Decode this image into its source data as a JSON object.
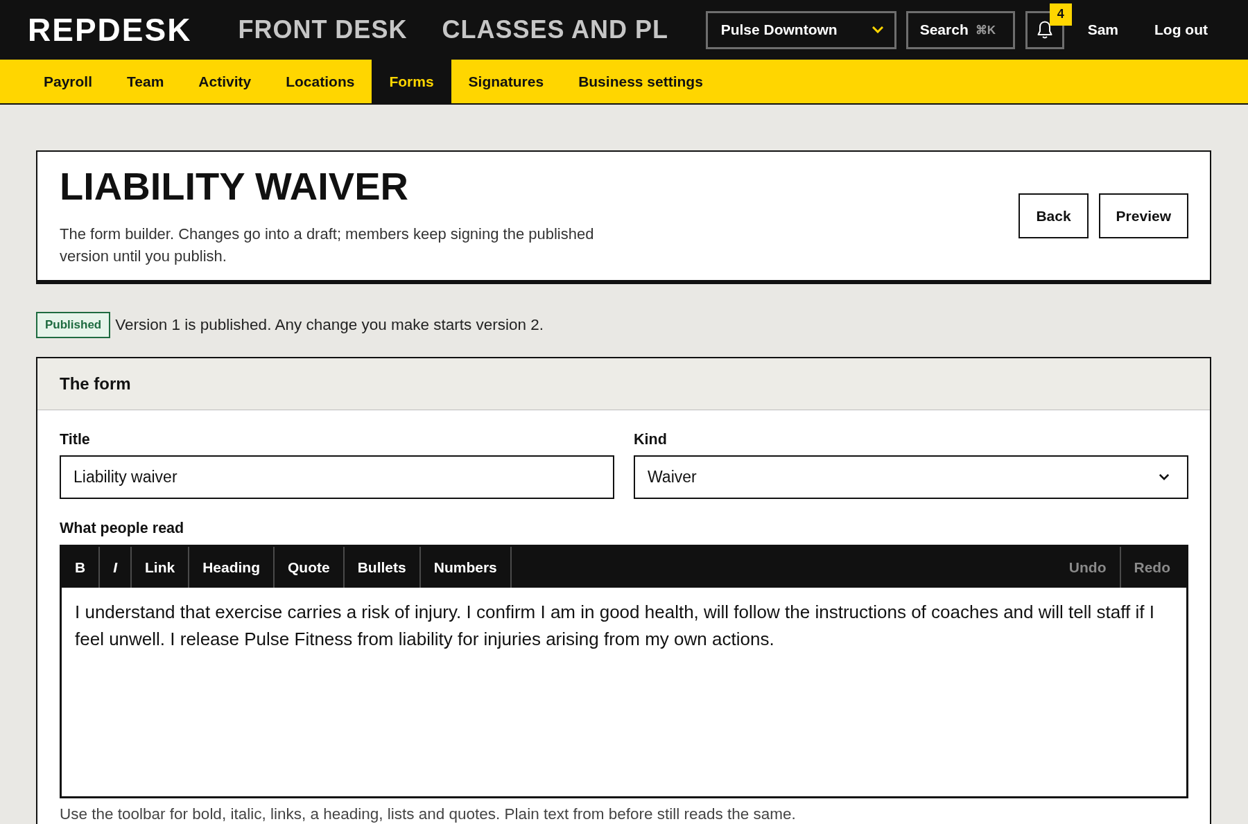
{
  "app": {
    "logo": "REPDESK"
  },
  "top_nav": [
    {
      "label": "FRONT DESK",
      "selected": false
    },
    {
      "label": "CLASSES AND PL",
      "selected": false
    }
  ],
  "location_select": {
    "value": "Pulse Downtown"
  },
  "search": {
    "label": "Search",
    "shortcut": "⌘K"
  },
  "notifications": {
    "count": "4"
  },
  "user": {
    "name": "Sam"
  },
  "logout": "Log out",
  "sub_nav": [
    {
      "label": "Payroll",
      "selected": false
    },
    {
      "label": "Team",
      "selected": false
    },
    {
      "label": "Activity",
      "selected": false
    },
    {
      "label": "Locations",
      "selected": false
    },
    {
      "label": "Forms",
      "selected": true
    },
    {
      "label": "Signatures",
      "selected": false
    },
    {
      "label": "Business settings",
      "selected": false
    }
  ],
  "page_header": {
    "title": "LIABILITY WAIVER",
    "description": "The form builder. Changes go into a draft; members keep signing the published version until you publish.",
    "buttons": [
      "Back",
      "Preview"
    ]
  },
  "status": {
    "badge": "Published",
    "message": "Version 1 is published. Any change you make starts version 2."
  },
  "form_card": {
    "heading": "The form",
    "title_field": {
      "label": "Title",
      "value": "Liability waiver"
    },
    "kind_field": {
      "label": "Kind",
      "value": "Waiver"
    },
    "body_field": {
      "label": "What people read",
      "toolbar": [
        {
          "label": "B",
          "kind": "bold",
          "disabled": false
        },
        {
          "label": "I",
          "kind": "italic",
          "disabled": false
        },
        {
          "label": "Link",
          "kind": "insert",
          "disabled": false
        },
        {
          "label": "Heading",
          "kind": "insert",
          "disabled": false
        },
        {
          "label": "Quote",
          "kind": "insert",
          "disabled": false
        },
        {
          "label": "Bullets",
          "kind": "insert",
          "disabled": false
        },
        {
          "label": "Numbers",
          "kind": "insert",
          "disabled": false
        },
        {
          "label": "Undo",
          "kind": "history",
          "disabled": true
        },
        {
          "label": "Redo",
          "kind": "history",
          "disabled": true
        }
      ],
      "text": "I understand that exercise carries a risk of injury. I confirm I am in good health, will follow the instructions of coaches and will tell staff if I feel unwell. I release Pulse Fitness from liability for injuries arising from my own actions.",
      "hint": "Use the toolbar for bold, italic, links, a heading, lists and quotes. Plain text from before still reads the same."
    }
  }
}
